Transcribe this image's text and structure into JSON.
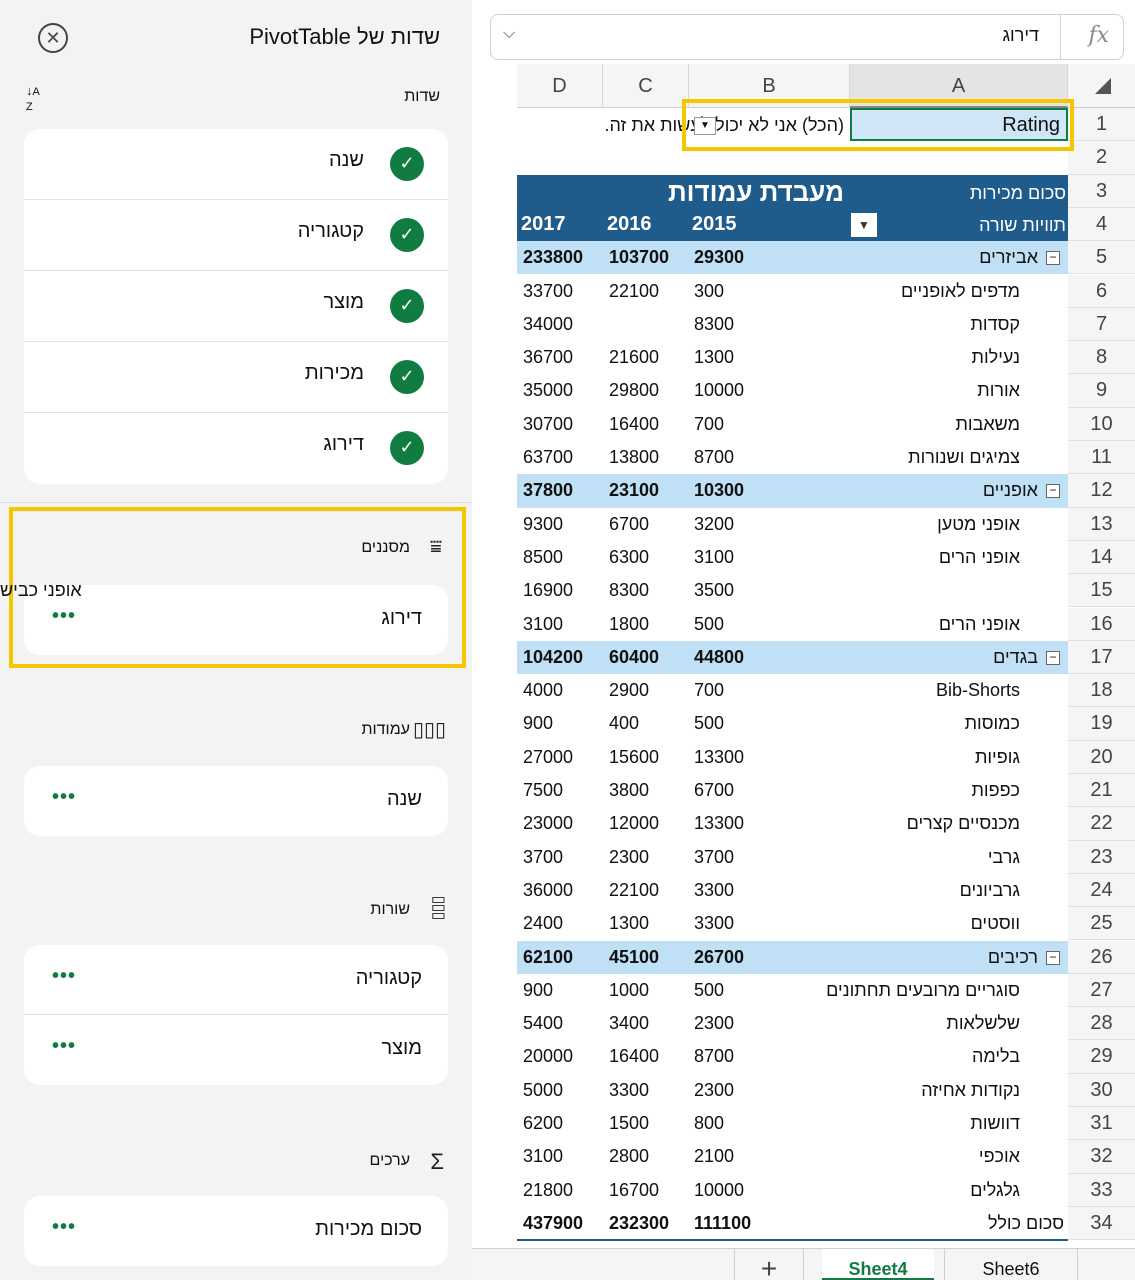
{
  "pane": {
    "title": "שדות של PivotTable",
    "fields_label": "שדות",
    "fields": [
      "שנה",
      "קטגוריה",
      "מוצר",
      "מכירות",
      "דירוג"
    ],
    "filters_label": "מסננים",
    "filters": [
      "דירוג"
    ],
    "filter_tooltip": "אופני כביש",
    "columns_label": "עמודות",
    "columns": [
      "שנה"
    ],
    "rows_label": "שורות",
    "rows": [
      "קטגוריה",
      "מוצר"
    ],
    "values_label": "ערכים",
    "values": [
      "סכום מכירות"
    ],
    "more_glyph": "•••"
  },
  "formula_bar": {
    "value": "דירוג",
    "fx": "fx"
  },
  "columns": [
    "A",
    "B",
    "C",
    "D"
  ],
  "row_numbers": [
    "1",
    "2",
    "3",
    "4",
    "5",
    "6",
    "7",
    "8",
    "9",
    "10",
    "11",
    "12",
    "13",
    "14",
    "15",
    "16",
    "17",
    "18",
    "19",
    "20",
    "21",
    "22",
    "23",
    "24",
    "25",
    "26",
    "27",
    "28",
    "29",
    "30",
    "31",
    "32",
    "33",
    "34"
  ],
  "filter_row": {
    "label": "Rating",
    "value": "(הכל) אני לא יכול לעשות את זה."
  },
  "pivot": {
    "title": "מעבדת עמודות",
    "sum_label": "סכום מכירות",
    "row_labels": "תוויות שורה",
    "years": [
      "2015",
      "2016",
      "2017"
    ]
  },
  "data_rows": [
    {
      "label": "אביזרים",
      "group": true,
      "v": [
        "29300",
        "103700",
        "233800"
      ]
    },
    {
      "label": "מדפים לאופניים",
      "v": [
        "300",
        "22100",
        "33700"
      ]
    },
    {
      "label": "קסדות",
      "v": [
        "8300",
        "",
        "34000"
      ]
    },
    {
      "label": "נעילות",
      "v": [
        "1300",
        "21600",
        "36700"
      ]
    },
    {
      "label": "אורות",
      "v": [
        "10000",
        "29800",
        "35000"
      ]
    },
    {
      "label": "משאבות",
      "v": [
        "700",
        "16400",
        "30700"
      ]
    },
    {
      "label": "צמיגים ושנורות",
      "v": [
        "8700",
        "13800",
        "63700"
      ]
    },
    {
      "label": "אופניים",
      "group": true,
      "v": [
        "10300",
        "23100",
        "37800"
      ]
    },
    {
      "label": "אופני מטען",
      "v": [
        "3200",
        "6700",
        "9300"
      ]
    },
    {
      "label": "אופני הרים",
      "v": [
        "3100",
        "6300",
        "8500"
      ]
    },
    {
      "label": "",
      "v": [
        "3500",
        "8300",
        "16900"
      ]
    },
    {
      "label": "אופני הרים",
      "v": [
        "500",
        "1800",
        "3100"
      ]
    },
    {
      "label": "בגדים",
      "group": true,
      "v": [
        "44800",
        "60400",
        "104200"
      ]
    },
    {
      "label": "Bib-Shorts",
      "v": [
        "700",
        "2900",
        "4000"
      ]
    },
    {
      "label": "כמוסות",
      "v": [
        "500",
        "400",
        "900"
      ]
    },
    {
      "label": "גופיות",
      "v": [
        "13300",
        "15600",
        "27000"
      ]
    },
    {
      "label": "כפפות",
      "v": [
        "6700",
        "3800",
        "7500"
      ]
    },
    {
      "label": "מכנסיים קצרים",
      "v": [
        "13300",
        "12000",
        "23000"
      ]
    },
    {
      "label": "גרבי",
      "v": [
        "3700",
        "2300",
        "3700"
      ]
    },
    {
      "label": "גרביונים",
      "v": [
        "3300",
        "22100",
        "36000"
      ]
    },
    {
      "label": "ווסטים",
      "v": [
        "3300",
        "1300",
        "2400"
      ]
    },
    {
      "label": "רכיבים",
      "group": true,
      "v": [
        "26700",
        "45100",
        "62100"
      ]
    },
    {
      "label": "סוגריים מרובעים תחתונים",
      "v": [
        "500",
        "1000",
        "900"
      ]
    },
    {
      "label": "שלשלאות",
      "v": [
        "2300",
        "3400",
        "5400"
      ]
    },
    {
      "label": "בלימה",
      "v": [
        "8700",
        "16400",
        "20000"
      ]
    },
    {
      "label": "נקודות אחיזה",
      "v": [
        "2300",
        "3300",
        "5000"
      ]
    },
    {
      "label": "דוושות",
      "v": [
        "800",
        "1500",
        "6200"
      ]
    },
    {
      "label": "אוכפי",
      "v": [
        "2100",
        "2800",
        "3100"
      ]
    },
    {
      "label": "גלגלים",
      "v": [
        "10000",
        "16700",
        "21800"
      ]
    },
    {
      "label": "סכום כולל",
      "total": true,
      "v": [
        "111100",
        "232300",
        "437900"
      ]
    }
  ],
  "sheets": {
    "plus": "+",
    "active": "Sheet4",
    "other": "Sheet6"
  }
}
